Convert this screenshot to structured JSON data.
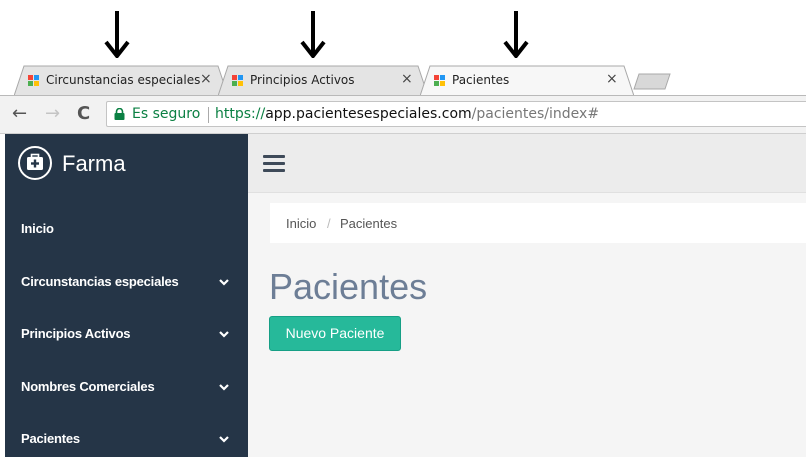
{
  "browser": {
    "tabs": [
      {
        "title": "Circunstancias especiales",
        "close": "×"
      },
      {
        "title": "Principios Activos",
        "close": "×"
      },
      {
        "title": "Pacientes",
        "close": "×",
        "active": true
      }
    ],
    "nav": {
      "back": "←",
      "forward": "→",
      "reload": "C"
    },
    "secure_label": "Es seguro",
    "url": {
      "scheme": "https://",
      "host": "app.pacientesespeciales.com",
      "path": "/pacientes/index#"
    },
    "favicon_colors": [
      "#f44336",
      "#2196f3",
      "#4caf50",
      "#ffc107"
    ]
  },
  "app": {
    "brand": "Farma",
    "sidebar": {
      "items": [
        {
          "label": "Inicio",
          "has_submenu": false
        },
        {
          "label": "Circunstancias especiales",
          "has_submenu": true
        },
        {
          "label": "Principios Activos",
          "has_submenu": true
        },
        {
          "label": "Nombres Comerciales",
          "has_submenu": true
        },
        {
          "label": "Pacientes",
          "has_submenu": true
        }
      ]
    },
    "breadcrumb": {
      "items": [
        "Inicio",
        "Pacientes"
      ],
      "separator": "/"
    },
    "page_title": "Pacientes",
    "new_button": "Nuevo Paciente"
  },
  "colors": {
    "sidebar_bg": "#253547",
    "primary_button": "#26b99a",
    "title_text": "#6d7e96",
    "secure_green": "#0b8043"
  },
  "icons": [
    "arrow-down-icon",
    "favicon-icon",
    "close-icon",
    "back-icon",
    "forward-icon",
    "reload-icon",
    "lock-icon",
    "medkit-icon",
    "chevron-down-icon",
    "hamburger-icon"
  ]
}
